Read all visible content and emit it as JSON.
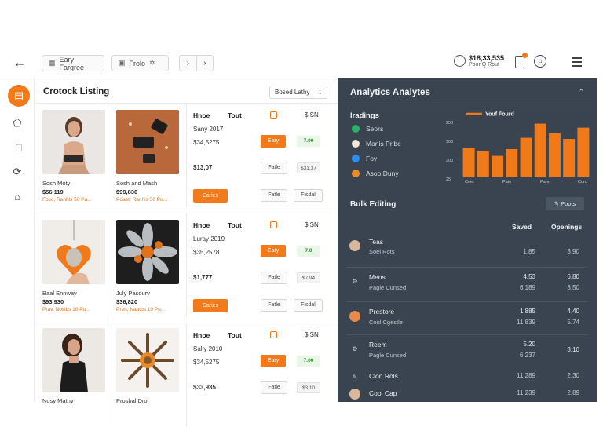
{
  "topbar": {
    "btn1": "Eary Fargree",
    "btn2": "Frolo",
    "account_value": "$18,33,535",
    "account_sub": "Poor Q Rout"
  },
  "listing": {
    "title": "Crotock Listing",
    "select": "Bosed Lathy",
    "products": [
      {
        "name": "Sosh Moty",
        "price": "$56,119",
        "sub": "Foso, Ranhls 50 Pu..."
      },
      {
        "name": "Sosh and Mash",
        "price": "$99,830",
        "sub": "Poaet, Ranhis 50 Pu..."
      },
      {
        "name": "Baal Ennway",
        "price": "$93,930",
        "sub": "Prav, Nowbs 10 Pu..."
      },
      {
        "name": "July Pasoury",
        "price": "$36,820",
        "sub": "Pren, Nautbs 10 Pu..."
      },
      {
        "name": "Nosy Mathy",
        "price": "",
        "sub": ""
      },
      {
        "name": "Prosbal Dror",
        "price": "",
        "sub": ""
      }
    ],
    "details": [
      {
        "h1": "Hnoe",
        "h2": "Tout",
        "money": "$ SN",
        "t1": "Sany 2017",
        "t2": "$34,5275",
        "edit": "Eary",
        "badge": "7.00",
        "price2": "$13,07",
        "b2": "Fatle",
        "p2": "$31,37",
        "cta": "Caries",
        "b3": "Fatle",
        "b4": "Fisdal"
      },
      {
        "h1": "Hnoe",
        "h2": "Tout",
        "money": "$ SN",
        "t1": "Luray 2019",
        "t2": "$35,2578",
        "edit": "Eary",
        "badge": "7.0",
        "price2": "$1,777",
        "b2": "Fatle",
        "p2": "$7,94",
        "cta": "Caries",
        "b3": "Fatle",
        "b4": "Fisdal"
      },
      {
        "h1": "Hnoe",
        "h2": "Tout",
        "money": "$ SN",
        "t1": "Sally 2010",
        "t2": "$34,5275",
        "edit": "Eary",
        "badge": "7.00",
        "price2": "$33,935",
        "b2": "Fatle",
        "p2": "$3,10",
        "cta": "",
        "b3": "",
        "b4": ""
      }
    ]
  },
  "analytics": {
    "title": "Analytics Analytes",
    "legend_title": "Iradings",
    "legend": [
      {
        "label": "Seors",
        "color": "#27b36a"
      },
      {
        "label": "Manis Pribe",
        "color": "#f4e9d8"
      },
      {
        "label": "Foy",
        "color": "#2d8ef0"
      },
      {
        "label": "Asoo Duny",
        "color": "#f08a24"
      }
    ]
  },
  "chart_data": {
    "type": "bar",
    "title": "",
    "line_label": "Youf Fourd",
    "y_ticks": [
      "250",
      "300",
      "200",
      "25"
    ],
    "x_ticks": [
      "Ceet",
      "Pato",
      "Pare",
      "Curu"
    ],
    "values": [
      52,
      46,
      38,
      50,
      70,
      95,
      78,
      68,
      88
    ],
    "ylim": [
      0,
      100
    ],
    "bar_color": "#f07a1a"
  },
  "bulk": {
    "title": "Bulk Editing",
    "button": "Poots",
    "col_saved": "Saved",
    "col_openings": "Openings",
    "rows": [
      {
        "icon": "person-icon",
        "t1": "Teas",
        "t2": "Soel Rots",
        "c1": "",
        "c2": "1.85",
        "c3": "",
        "c4": "3.90"
      },
      {
        "icon": "shoe-icon",
        "t1": "Mens",
        "t2": "Pagle Cunsed",
        "c1": "4.53",
        "c2": "6.189",
        "c3": "6.80",
        "c4": "3.50"
      },
      {
        "icon": "person-orange-icon",
        "t1": "Prestore",
        "t2": "Conl Cgestle",
        "c1": "1.885",
        "c2": "11.839",
        "c3": "4.40",
        "c4": "5.74"
      },
      {
        "icon": "shoe-icon",
        "t1": "Reem",
        "t2": "Pagle Cunsed",
        "c1": "5.20",
        "c2": "6.237",
        "c3": "3.10",
        "c4": ""
      },
      {
        "icon": "pen-icon",
        "t1": "Clon Rols",
        "t2": "",
        "c1": "",
        "c2": "11.289",
        "c3": "",
        "c4": "2.30"
      },
      {
        "icon": "person-icon",
        "t1": "Cool Cap",
        "t2": "",
        "c1": "",
        "c2": "11.239",
        "c3": "",
        "c4": "2.89"
      }
    ]
  }
}
